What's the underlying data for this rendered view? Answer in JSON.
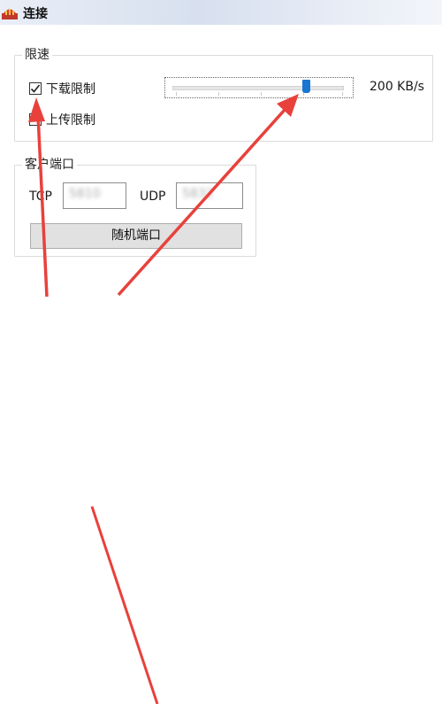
{
  "window": {
    "title": "连接",
    "icon": "app-icon"
  },
  "speed_limit": {
    "group_title": "限速",
    "download_label": "下载限制",
    "download_checked": true,
    "upload_label": "上传限制",
    "upload_checked": false,
    "slider_level_fraction": 0.78,
    "slider_value": "200 KB/s"
  },
  "client_port": {
    "group_title": "客户端口",
    "tcp_label": "TCP",
    "tcp_value": "5810",
    "udp_label": "UDP",
    "udp_value": "5832",
    "random_button": "随机端口"
  },
  "colors": {
    "accent": "#1975d2",
    "annotation": "#e8413c"
  }
}
